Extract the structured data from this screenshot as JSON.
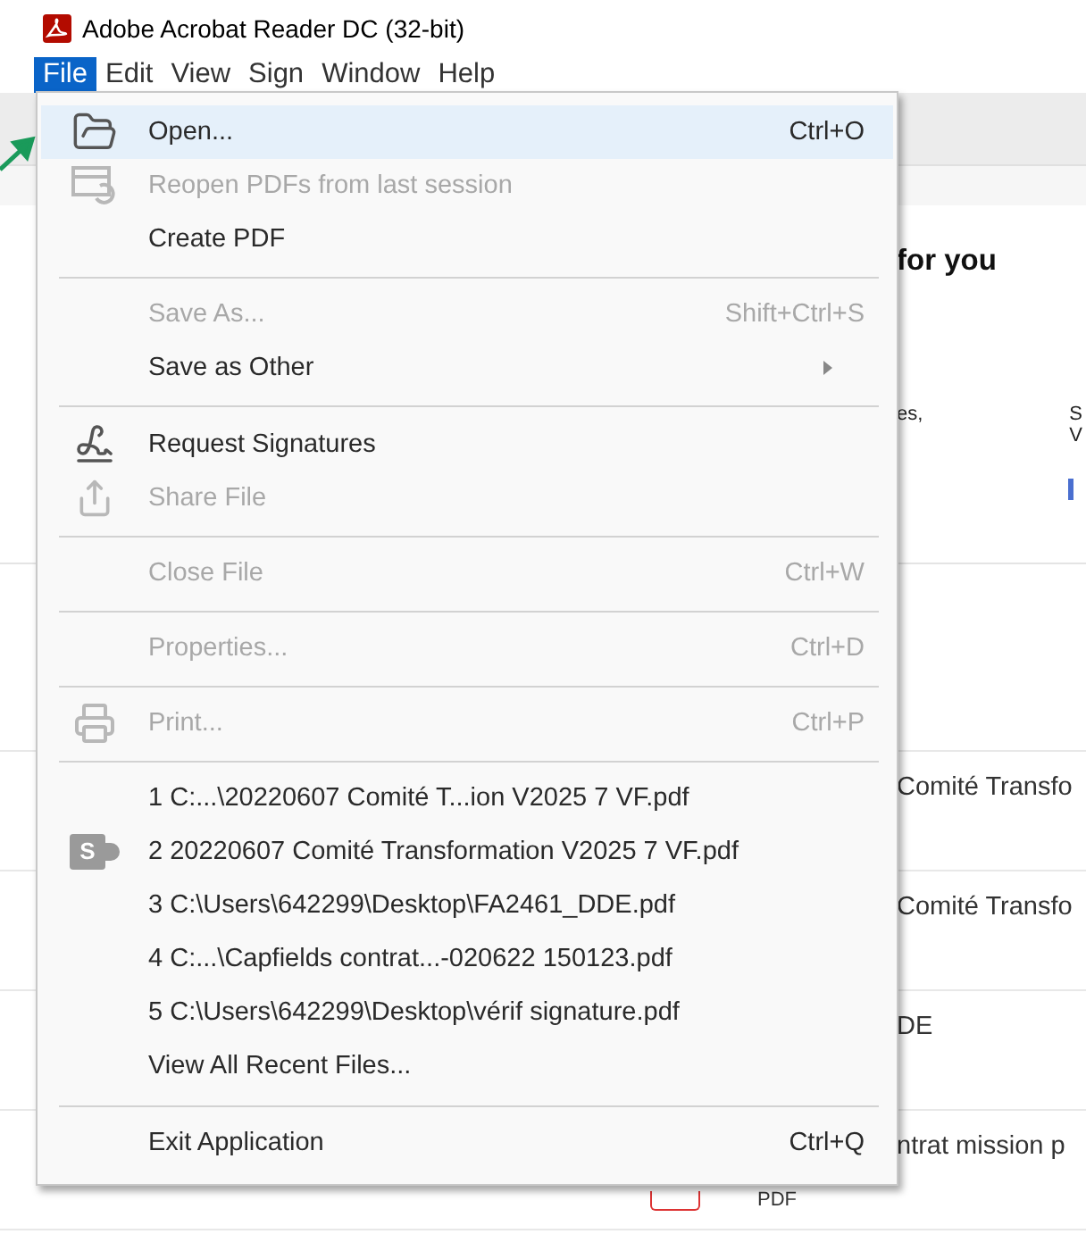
{
  "window": {
    "title": "Adobe Acrobat Reader DC (32-bit)"
  },
  "menubar": [
    {
      "label": "File",
      "selected": true
    },
    {
      "label": "Edit",
      "selected": false
    },
    {
      "label": "View",
      "selected": false
    },
    {
      "label": "Sign",
      "selected": false
    },
    {
      "label": "Window",
      "selected": false
    },
    {
      "label": "Help",
      "selected": false
    }
  ],
  "file_menu": [
    {
      "kind": "folder",
      "label": "Open...",
      "shortcut": "Ctrl+O",
      "disabled": false,
      "selected": true
    },
    {
      "kind": "reopen",
      "label": "Reopen PDFs from last session",
      "disabled": true,
      "selected": false
    },
    {
      "kind": "item",
      "label": "Create PDF",
      "disabled": false,
      "selected": false
    },
    {
      "kind": "separator"
    },
    {
      "kind": "item",
      "label": "Save As...",
      "shortcut": "Shift+Ctrl+S",
      "disabled": true,
      "selected": false
    },
    {
      "kind": "item",
      "label": "Save as Other",
      "submenu": true,
      "disabled": false,
      "selected": false
    },
    {
      "kind": "separator"
    },
    {
      "kind": "signature",
      "label": "Request Signatures",
      "disabled": false,
      "selected": false
    },
    {
      "kind": "share",
      "label": "Share File",
      "disabled": true,
      "selected": false
    },
    {
      "kind": "separator"
    },
    {
      "kind": "item",
      "label": "Close File",
      "shortcut": "Ctrl+W",
      "disabled": true,
      "selected": false
    },
    {
      "kind": "separator"
    },
    {
      "kind": "item",
      "label": "Properties...",
      "shortcut": "Ctrl+D",
      "disabled": true,
      "selected": false
    },
    {
      "kind": "separator"
    },
    {
      "kind": "printer",
      "label": "Print...",
      "shortcut": "Ctrl+P",
      "disabled": true,
      "selected": false
    },
    {
      "kind": "separator"
    },
    {
      "kind": "item",
      "label": "1 C:...\\20220607 Comité T...ion V2025 7 VF.pdf",
      "disabled": false,
      "selected": false
    },
    {
      "kind": "sharepoint",
      "label": "2 20220607 Comité Transformation V2025 7 VF.pdf",
      "badge": "S",
      "disabled": false,
      "selected": false
    },
    {
      "kind": "item",
      "label": "3 C:\\Users\\642299\\Desktop\\FA2461_DDE.pdf",
      "disabled": false,
      "selected": false
    },
    {
      "kind": "item",
      "label": "4 C:...\\Capfields contrat...-020622 150123.pdf",
      "disabled": false,
      "selected": false
    },
    {
      "kind": "item",
      "label": "5 C:\\Users\\642299\\Desktop\\vérif signature.pdf",
      "disabled": false,
      "selected": false
    },
    {
      "kind": "item",
      "label": "View All Recent Files...",
      "disabled": false,
      "selected": false
    },
    {
      "kind": "separator"
    },
    {
      "kind": "item",
      "label": "Exit Application",
      "shortcut": "Ctrl+Q",
      "disabled": false,
      "selected": false
    }
  ],
  "background": {
    "heading": "for you",
    "card_text": "es,",
    "edge_lines": [
      "S",
      "V"
    ],
    "recent_rows": [
      {
        "name": "Comité Transfo"
      },
      {
        "name": "Comité Transfo"
      },
      {
        "name": "DE"
      },
      {
        "name": "ntrat mission p",
        "type": "PDF"
      }
    ]
  }
}
